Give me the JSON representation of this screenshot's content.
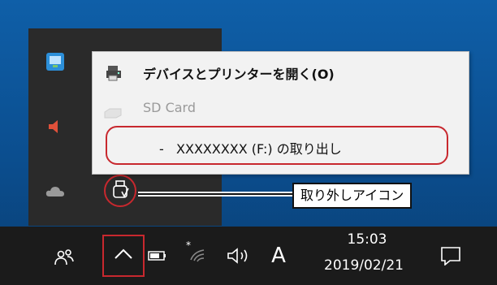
{
  "menu": {
    "items": [
      {
        "label": "デバイスとプリンターを開く(O)",
        "icon": "printer-icon"
      },
      {
        "label": "SD Card",
        "icon": "sd-card-icon"
      },
      {
        "label": "-   XXXXXXXX (F:) の取り出し"
      }
    ]
  },
  "callout": {
    "label": "取り外しアイコン"
  },
  "taskbar": {
    "ime_label": "A",
    "clock_time": "15:03",
    "clock_date": "2019/02/21"
  },
  "colors": {
    "highlight": "#c8282e",
    "taskbar": "#1b1b1b",
    "desktop": "#0f5fa8"
  }
}
